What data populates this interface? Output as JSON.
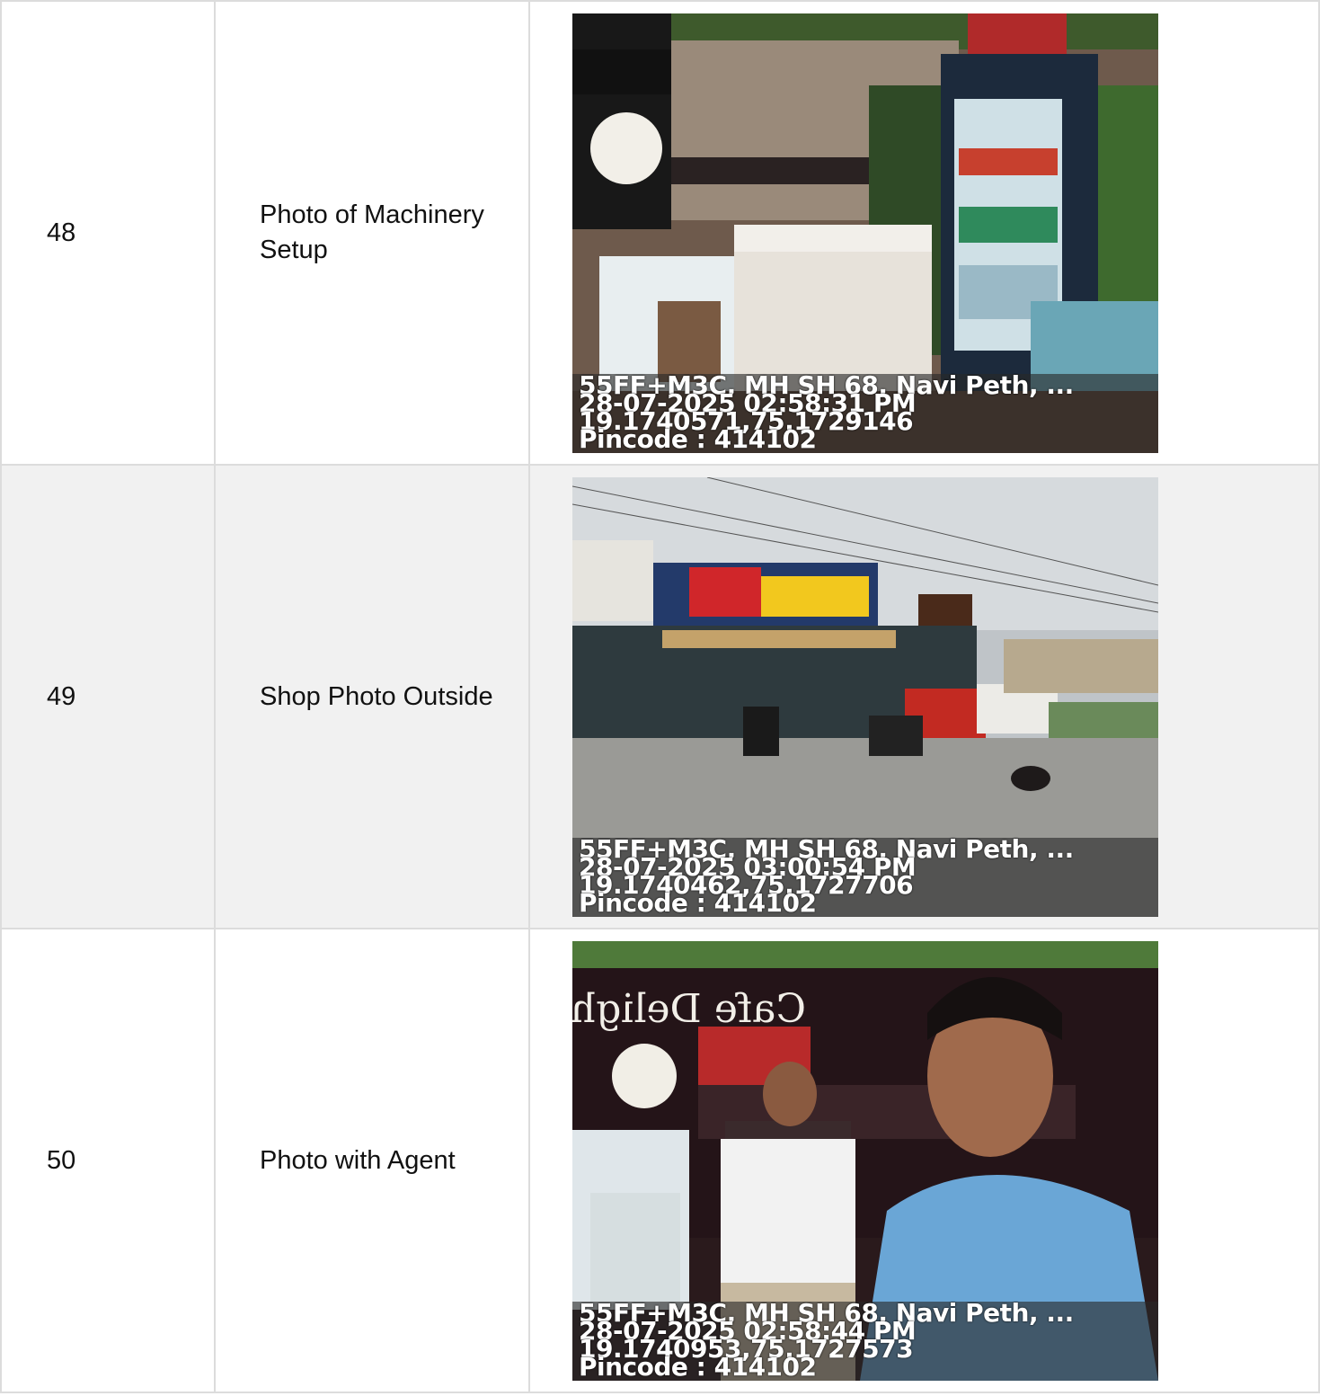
{
  "rows": [
    {
      "number": "48",
      "label": "Photo of Machinery Setup",
      "photo": {
        "subject": "shop-interior-fridge-freezers",
        "stamp": {
          "address": "55FF+M3C, MH SH 68, Navi Peth, ...",
          "datetime": "28-07-2025 02:58:31 PM",
          "coords": "19.1740571,75.1729146",
          "pincode": "Pincode : 414102"
        }
      }
    },
    {
      "number": "49",
      "label": "Shop Photo Outside",
      "photo": {
        "subject": "shop-exterior-street",
        "stamp": {
          "address": "55FF+M3C, MH SH 68, Navi Peth, ...",
          "datetime": "28-07-2025 03:00:54 PM",
          "coords": "19.1740462,75.1727706",
          "pincode": "Pincode : 414102"
        }
      }
    },
    {
      "number": "50",
      "label": "Photo with Agent",
      "photo": {
        "subject": "selfie-with-shop-owner",
        "sign_text": "Cafe Delight",
        "stamp": {
          "address": "55FF+M3C, MH SH 68, Navi Peth, ...",
          "datetime": "28-07-2025 02:58:44 PM",
          "coords": "19.1740953,75.1727573",
          "pincode": "Pincode : 414102"
        }
      }
    }
  ],
  "colors": {
    "border": "#dcdcdc",
    "shaded_row": "#f1f1f1"
  }
}
